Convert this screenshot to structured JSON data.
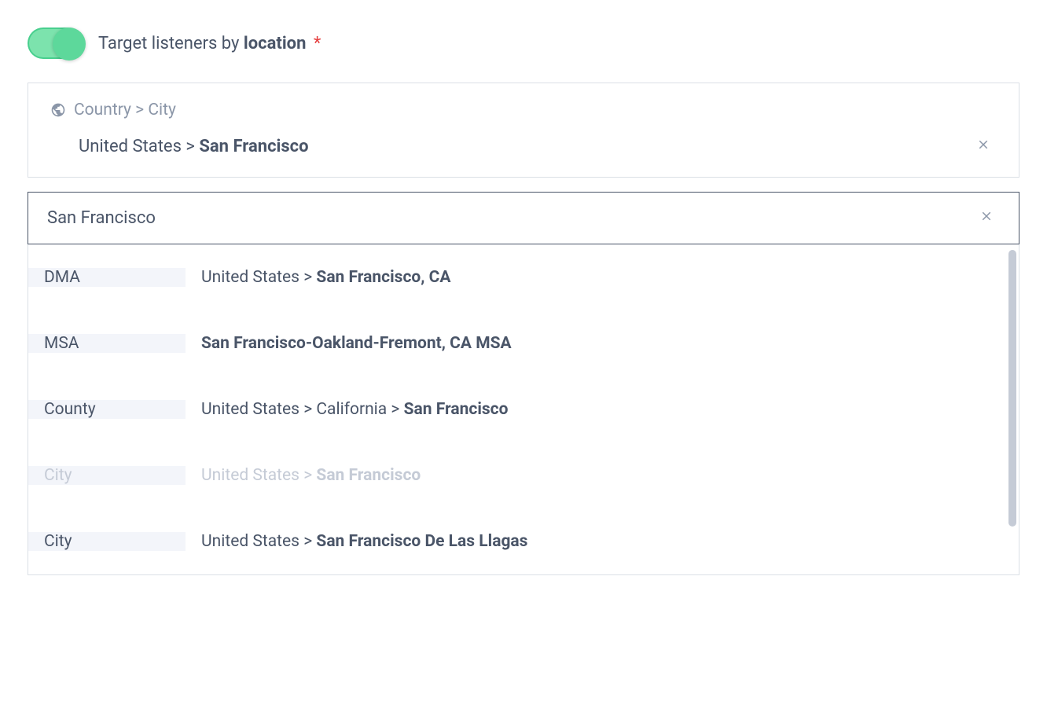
{
  "header": {
    "label_prefix": "Target listeners by ",
    "label_bold": "location",
    "required_marker": "*",
    "toggle_on": true
  },
  "selected": {
    "breadcrumb": "Country > City",
    "items": [
      {
        "prefix": "United States > ",
        "bold": "San Francisco"
      }
    ]
  },
  "search": {
    "value": "San Francisco"
  },
  "results": [
    {
      "type": "DMA",
      "prefix": "United States > ",
      "bold": "San Francisco, CA",
      "suffix": "",
      "disabled": false
    },
    {
      "type": "MSA",
      "prefix": "",
      "bold": "San Francisco-Oakland-Fremont, CA MSA",
      "suffix": "",
      "disabled": false
    },
    {
      "type": "County",
      "prefix": "United States > California > ",
      "bold": "San Francisco",
      "suffix": "",
      "disabled": false
    },
    {
      "type": "City",
      "prefix": "United States > ",
      "bold": "San Francisco",
      "suffix": "",
      "disabled": true
    },
    {
      "type": "City",
      "prefix": "United States > ",
      "bold": "San Francisco De Las Llagas",
      "suffix": "",
      "disabled": false
    }
  ]
}
